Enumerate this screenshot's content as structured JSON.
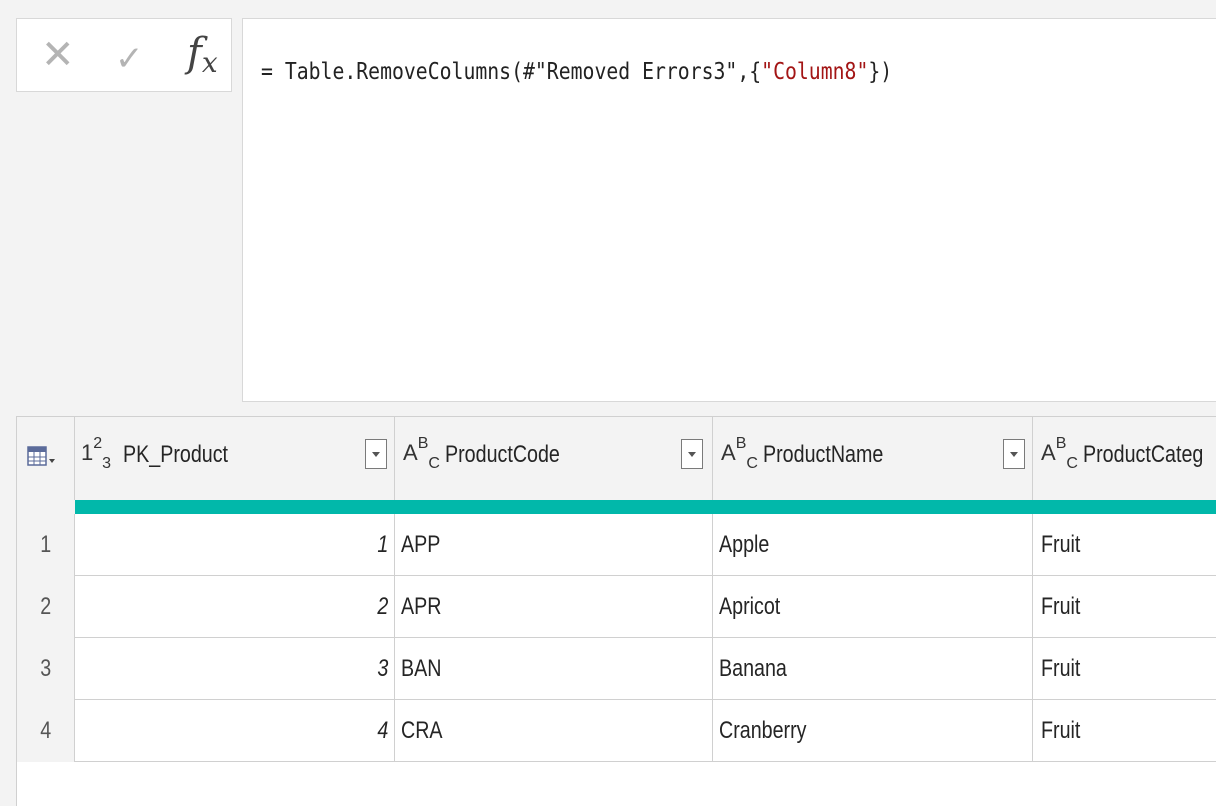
{
  "formula_bar": {
    "cancel_icon": "✕",
    "commit_icon": "✓",
    "fx_label": "f",
    "fx_sub": "x",
    "formula_prefix": "= Table.RemoveColumns(#\"Removed Errors3\",{",
    "formula_string": "\"Column8\"",
    "formula_suffix": "})"
  },
  "grid": {
    "columns": [
      {
        "type_up": "2",
        "type_main": "1",
        "type_dn": "3",
        "label": "PK_Product"
      },
      {
        "type_up": "B",
        "type_main": "A",
        "type_dn": "C",
        "label": "ProductCode"
      },
      {
        "type_up": "B",
        "type_main": "A",
        "type_dn": "C",
        "label": "ProductName"
      },
      {
        "type_up": "B",
        "type_main": "A",
        "type_dn": "C",
        "label": "ProductCateg"
      }
    ],
    "rows": [
      {
        "n": "1",
        "pk": "1",
        "code": "APP",
        "name": "Apple",
        "cat": "Fruit"
      },
      {
        "n": "2",
        "pk": "2",
        "code": "APR",
        "name": "Apricot",
        "cat": "Fruit"
      },
      {
        "n": "3",
        "pk": "3",
        "code": "BAN",
        "name": "Banana",
        "cat": "Fruit"
      },
      {
        "n": "4",
        "pk": "4",
        "code": "CRA",
        "name": "Cranberry",
        "cat": "Fruit"
      }
    ],
    "quality_color": "#01b8aa"
  }
}
